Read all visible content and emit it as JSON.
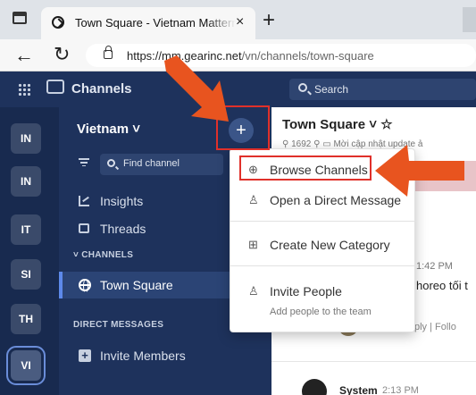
{
  "browser": {
    "tab_title": "Town Square - Vietnam Mattermost",
    "tab_close": "×",
    "new_tab": "+",
    "back": "←",
    "reload": "↻",
    "url_prefix": "https://",
    "url_host": "mm.gearinc.net",
    "url_path": "/vn/channels/town-square"
  },
  "header": {
    "product": "Channels",
    "search_placeholder": "Search"
  },
  "teams": [
    {
      "initials": "IN",
      "active": false
    },
    {
      "initials": "IN",
      "active": false
    },
    {
      "initials": "IT",
      "active": false
    },
    {
      "initials": "SI",
      "active": false
    },
    {
      "initials": "TH",
      "active": false
    },
    {
      "initials": "VI",
      "active": true
    }
  ],
  "sidebar": {
    "team_name": "Vietnam ˅",
    "add_button": "+",
    "find_placeholder": "Find channel",
    "insights": "Insights",
    "threads": "Threads",
    "channels_category": "˅ CHANNELS",
    "town_square": "Town Square",
    "dm_category": "DIRECT MESSAGES",
    "invite_members": "Invite Members",
    "invite_icon": "+"
  },
  "main": {
    "channel_title": "Town Square ˅  ☆",
    "meta": "⚲ 1692  ⚲  ▭  Mời cập nhật update ả",
    "msg_time": "1:42 PM",
    "msg_text": "horeo tối t",
    "msg_actions": "ply  |  Follo",
    "system_name": "System",
    "system_time": "2:13 PM"
  },
  "menu": {
    "browse": "Browse Channels",
    "direct": "Open a Direct Message",
    "create_category": "Create New Category",
    "invite": "Invite People",
    "invite_desc": "Add people to the team"
  },
  "colors": {
    "header_bg": "#1e325c",
    "team_sidebar_bg": "#182a4f",
    "highlight": "#e0302a",
    "arrow": "#e8541f"
  }
}
